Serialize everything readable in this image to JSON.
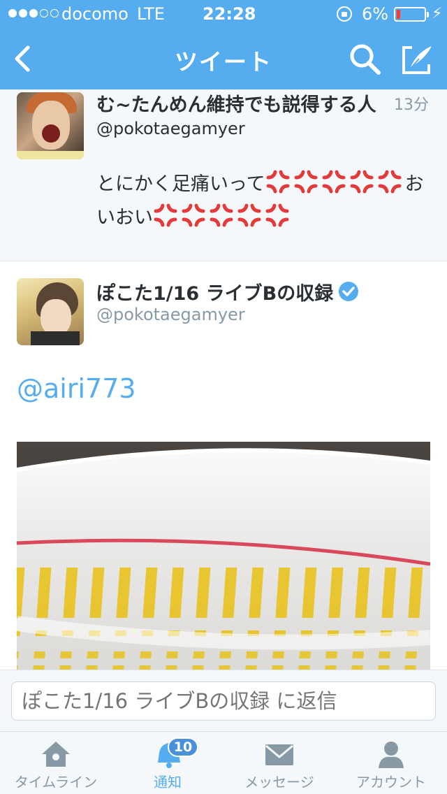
{
  "status_bar": {
    "carrier": "docomo",
    "network": "LTE",
    "time": "22:28",
    "battery": "6%"
  },
  "nav": {
    "title": "ツイート",
    "icons": [
      "back-icon",
      "search-icon",
      "compose-icon"
    ]
  },
  "previous_tweet": {
    "name": "む~たんめん維持でも説得する人",
    "handle": "@pokotaegamyer",
    "time": "13分",
    "text_part1": "とにかく足痛いって",
    "text_part2": "お",
    "text_part3": "いおい",
    "emoji_name": "anger-symbol"
  },
  "main_tweet": {
    "name": "ぽこた1/16 ライブBの収録",
    "handle": "@pokotaegamyer",
    "verified": true,
    "mention": "@airi773",
    "photo_icon": "noodle-cup-photo"
  },
  "reply": {
    "placeholder": "ぽこた1/16 ライブBの収録 に返信"
  },
  "tabs": [
    {
      "label": "タイムライン",
      "icon": "home-icon"
    },
    {
      "label": "通知",
      "icon": "bell-icon",
      "badge": "10"
    },
    {
      "label": "メッセージ",
      "icon": "envelope-icon"
    },
    {
      "label": "アカウント",
      "icon": "person-icon"
    }
  ],
  "colors": {
    "accent": "#55acee",
    "bar_background": "#f5f8fa",
    "anger": "#e23b3b"
  }
}
